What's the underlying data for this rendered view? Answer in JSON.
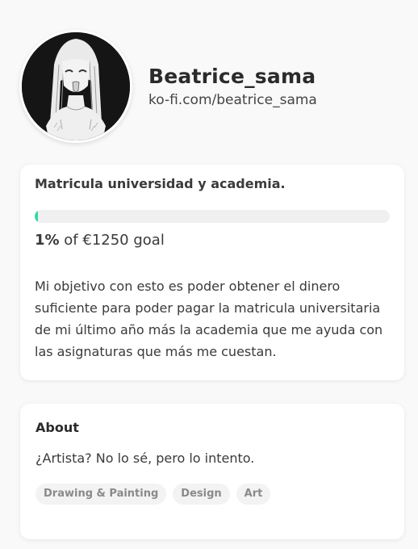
{
  "profile": {
    "name": "Beatrice_sama",
    "url": "ko-fi.com/beatrice_sama"
  },
  "goal": {
    "title": "Matricula universidad y academia.",
    "progress_fraction": 0.01,
    "percent_label": "1%",
    "amount_label": "of €1250 goal",
    "description": "Mi objetivo con esto es poder obtener el dinero suficiente para poder pagar la matricula universitaria de mi último año más la academia que me ayuda con las asignaturas que más me cuestan."
  },
  "about": {
    "title": "About",
    "text": "¿Artista? No lo sé, pero lo intento.",
    "tags": [
      "Drawing & Painting",
      "Design",
      "Art"
    ]
  },
  "colors": {
    "accent": "#38d6a9",
    "card_bg": "#ffffff",
    "page_bg": "#f9f9f9"
  }
}
